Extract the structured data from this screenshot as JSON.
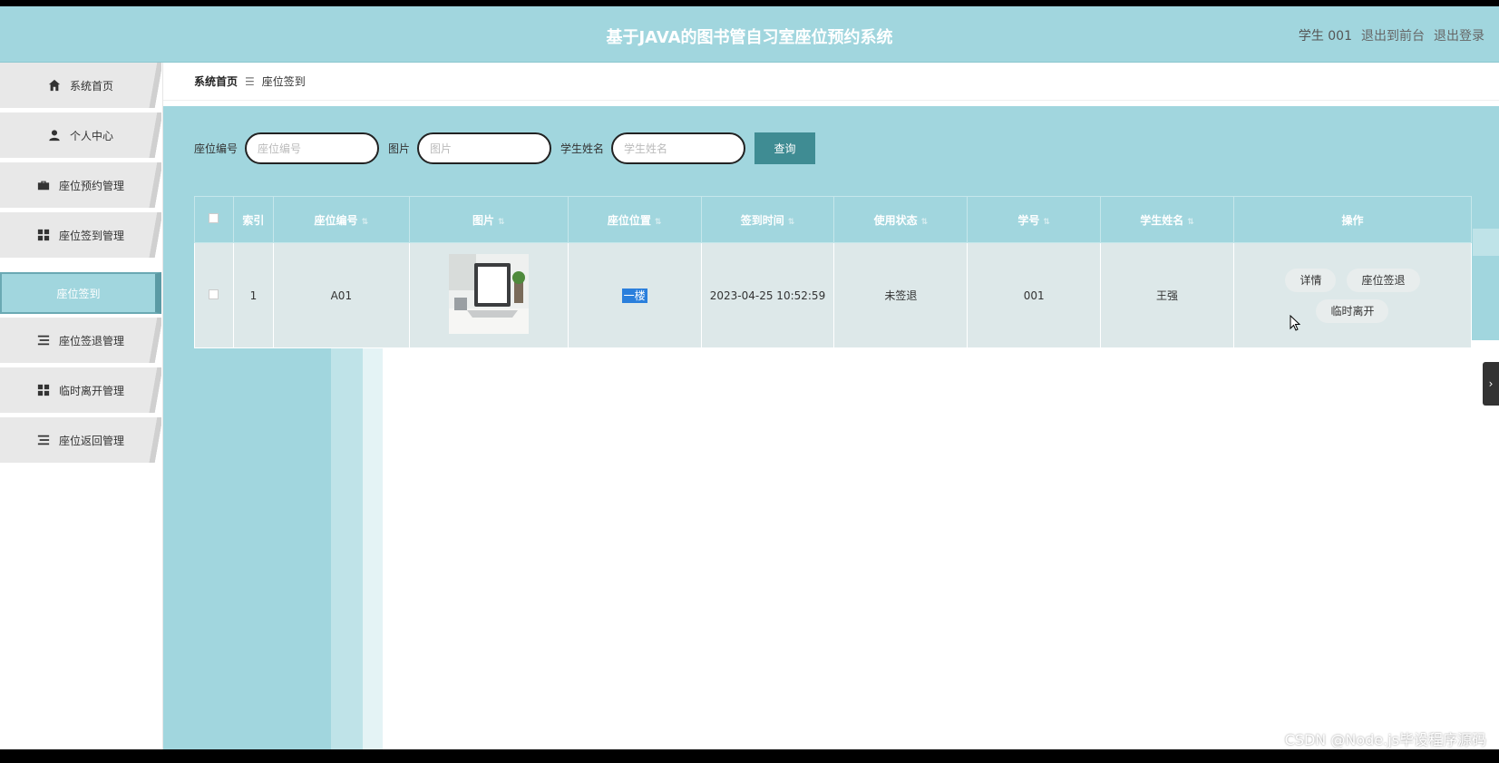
{
  "header": {
    "title": "基于JAVA的图书管自习室座位预约系统",
    "user_label": "学生 001",
    "front_link": "退出到前台",
    "logout_link": "退出登录"
  },
  "sidebar": {
    "items": [
      {
        "label": "系统首页",
        "icon": "home-icon"
      },
      {
        "label": "个人中心",
        "icon": "user-icon"
      },
      {
        "label": "座位预约管理",
        "icon": "briefcase-icon"
      },
      {
        "label": "座位签到管理",
        "icon": "grid-icon"
      },
      {
        "label": "座位签退管理",
        "icon": "list-icon"
      },
      {
        "label": "临时离开管理",
        "icon": "grid-icon"
      },
      {
        "label": "座位返回管理",
        "icon": "list-icon"
      }
    ],
    "submenu_active": "座位签到"
  },
  "breadcrumb": {
    "home": "系统首页",
    "separator": "☰",
    "current": "座位签到"
  },
  "search": {
    "seat_label": "座位编号",
    "seat_placeholder": "座位编号",
    "image_label": "图片",
    "image_placeholder": "图片",
    "student_label": "学生姓名",
    "student_placeholder": "学生姓名",
    "button": "查询"
  },
  "table": {
    "headers": [
      "索引",
      "座位编号",
      "图片",
      "座位位置",
      "签到时间",
      "使用状态",
      "学号",
      "学生姓名",
      "操作"
    ],
    "rows": [
      {
        "index": "1",
        "seat_no": "A01",
        "location": "一楼",
        "checkin_time": "2023-04-25 10:52:59",
        "status": "未签退",
        "student_no": "001",
        "student_name": "王强",
        "actions": [
          "详情",
          "座位签退",
          "临时离开"
        ]
      }
    ]
  },
  "watermark": "CSDN @Node.js毕设程序源码",
  "colors": {
    "header_bg": "#a1d6de",
    "search_button": "#3f8c93",
    "row_bg": "#dde8e9",
    "highlight": "#2a7fdc"
  }
}
